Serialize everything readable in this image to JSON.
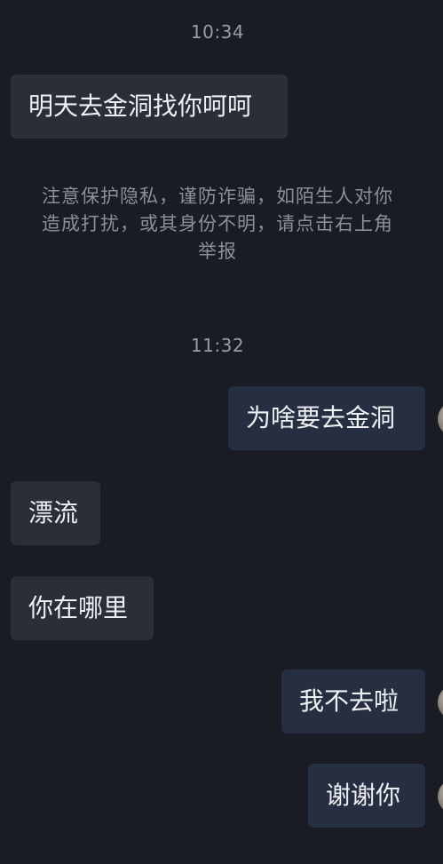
{
  "chat": {
    "timestamps": [
      "10:34",
      "11:32"
    ],
    "messages": [
      {
        "side": "incoming",
        "text": "明天去金洞找你呵呵"
      },
      {
        "side": "outgoing",
        "text": "为啥要去金洞"
      },
      {
        "side": "incoming",
        "text": "漂流"
      },
      {
        "side": "incoming",
        "text": "你在哪里"
      },
      {
        "side": "outgoing",
        "text": "我不去啦"
      },
      {
        "side": "outgoing",
        "text": "谢谢你"
      }
    ],
    "notice": {
      "line1": "注意保护隐私，谨防诈骗，如陌生人对你",
      "line2": "造成打扰，或其身份不明，请点击右上角",
      "line3": "举报"
    }
  }
}
